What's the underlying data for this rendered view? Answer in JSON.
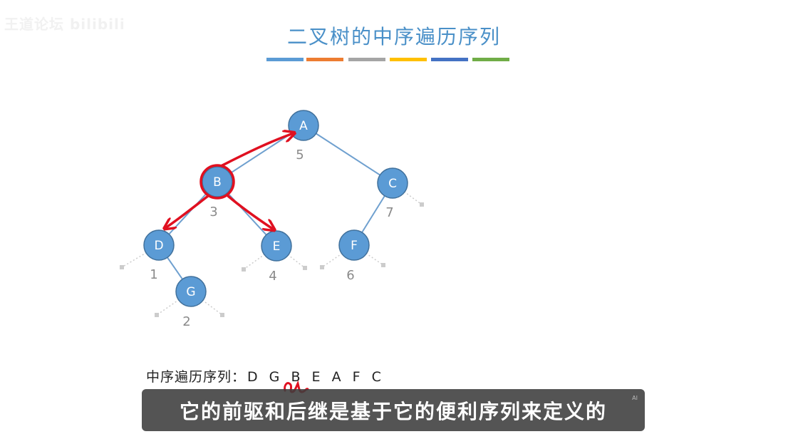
{
  "watermark": "王道论坛 bilibili",
  "title": "二叉树的中序遍历序列",
  "stripes": [
    "#5b9bd5",
    "#ed7d31",
    "#a5a5a5",
    "#ffc000",
    "#4472c4",
    "#70ad47"
  ],
  "tree": {
    "nodes": [
      {
        "id": "A",
        "order": "5"
      },
      {
        "id": "B",
        "order": "3"
      },
      {
        "id": "C",
        "order": "7"
      },
      {
        "id": "D",
        "order": "1"
      },
      {
        "id": "E",
        "order": "4"
      },
      {
        "id": "F",
        "order": "6"
      },
      {
        "id": "G",
        "order": "2"
      }
    ],
    "edges": [
      [
        "A",
        "B"
      ],
      [
        "A",
        "C"
      ],
      [
        "B",
        "D"
      ],
      [
        "B",
        "E"
      ],
      [
        "C",
        "F"
      ],
      [
        "D",
        "G"
      ]
    ],
    "highlighted_node": "B",
    "annotation_arrows": [
      [
        "B",
        "A"
      ],
      [
        "B",
        "D"
      ],
      [
        "B",
        "E"
      ]
    ],
    "colors": {
      "node_fill": "#5b9bd5",
      "node_stroke": "#41719c",
      "edge": "#6fa0cf",
      "ink": "#e01020",
      "order_text": "#8a8a8a",
      "null_leaf": "#cccccc"
    }
  },
  "sequence": {
    "label": "中序遍历序列：",
    "value": "DGBEAFC"
  },
  "subtitle": {
    "text": "它的前驱和后继是基于它的便利序列来定义的",
    "badge": "AI"
  }
}
